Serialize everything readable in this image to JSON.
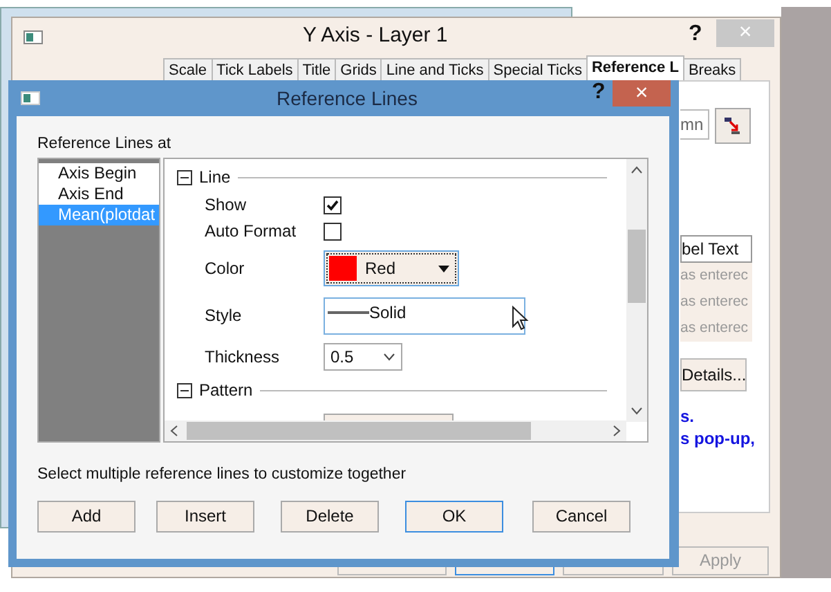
{
  "background_window": {
    "title": "Y Axis - Layer 1",
    "help": "?",
    "close": "×",
    "tabs": [
      {
        "label": "Scale",
        "selected": false
      },
      {
        "label": "Tick Labels",
        "selected": false
      },
      {
        "label": "Title",
        "selected": false
      },
      {
        "label": "Grids",
        "selected": false
      },
      {
        "label": "Line and Ticks",
        "selected": false
      },
      {
        "label": "Special Ticks",
        "selected": false
      },
      {
        "label": "Reference L",
        "selected": true
      },
      {
        "label": "Breaks",
        "selected": false
      }
    ],
    "column_field": {
      "value": "mn"
    },
    "table": {
      "header": "bel Text",
      "rows": [
        "as enterec",
        "as enterec",
        "as enterec"
      ]
    },
    "details_button": "Details...",
    "notes": [
      "s.",
      "s pop-up,"
    ],
    "buttons": [
      {
        "label": "Apply",
        "disabled": true
      }
    ]
  },
  "dialog": {
    "title": "Reference Lines",
    "help": "?",
    "close": "×",
    "list_label": "Reference Lines at",
    "list": [
      {
        "label": "Axis Begin",
        "selected": false
      },
      {
        "label": "Axis End",
        "selected": false
      },
      {
        "label": "Mean(plotdat",
        "selected": true
      }
    ],
    "sections": [
      {
        "title": "Line",
        "expanded": true,
        "rows": [
          {
            "kind": "checkbox",
            "label": "Show",
            "checked": true
          },
          {
            "kind": "checkbox",
            "label": "Auto Format",
            "checked": false
          },
          {
            "kind": "color",
            "label": "Color",
            "value": "Red",
            "color": "#ff0000"
          },
          {
            "kind": "style",
            "label": "Style",
            "value": "Solid"
          },
          {
            "kind": "select",
            "label": "Thickness",
            "value": "0.5"
          }
        ]
      },
      {
        "title": "Pattern",
        "expanded": true
      }
    ],
    "hint": "Select multiple reference lines to customize together",
    "buttons": [
      {
        "label": "Add",
        "default": false
      },
      {
        "label": "Insert",
        "default": false
      },
      {
        "label": "Delete",
        "default": false
      },
      {
        "label": "OK",
        "default": true
      },
      {
        "label": "Cancel",
        "default": false
      }
    ]
  }
}
